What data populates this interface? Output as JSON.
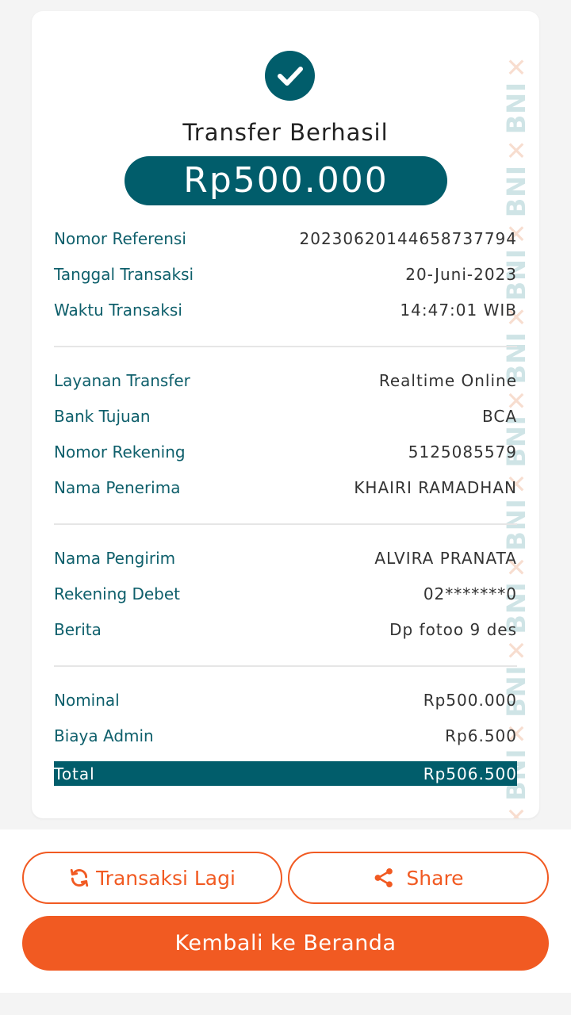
{
  "colors": {
    "teal": "#015d6b",
    "orange": "#f15a22",
    "label_teal": "#0e5f6b"
  },
  "status": {
    "icon": "check-icon",
    "title": "Transfer Berhasil",
    "amount": "Rp500.000"
  },
  "details_1": [
    {
      "label": "Nomor Referensi",
      "value": "20230620144658737794"
    },
    {
      "label": "Tanggal Transaksi",
      "value": "20-Juni-2023"
    },
    {
      "label": "Waktu Transaksi",
      "value": "14:47:01 WIB"
    }
  ],
  "details_2": [
    {
      "label": "Layanan Transfer",
      "value": "Realtime Online"
    },
    {
      "label": "Bank Tujuan",
      "value": "BCA"
    },
    {
      "label": "Nomor Rekening",
      "value": "5125085579"
    },
    {
      "label": "Nama Penerima",
      "value": "KHAIRI RAMADHAN"
    }
  ],
  "details_3": [
    {
      "label": "Nama Pengirim",
      "value": "ALVIRA PRANATA"
    },
    {
      "label": "Rekening Debet",
      "value": "02*******0"
    },
    {
      "label": "Berita",
      "value": "Dp fotoo 9 des"
    }
  ],
  "details_4": [
    {
      "label": "Nominal",
      "value": "Rp500.000"
    },
    {
      "label": "Biaya Admin",
      "value": "Rp6.500"
    }
  ],
  "total": {
    "label": "Total",
    "value": "Rp506.500"
  },
  "watermark": {
    "text": "BNI"
  },
  "actions": {
    "repeat_label": "Transaksi Lagi",
    "repeat_icon": "refresh-icon",
    "share_label": "Share",
    "share_icon": "share-icon",
    "home_label": "Kembali ke Beranda"
  }
}
